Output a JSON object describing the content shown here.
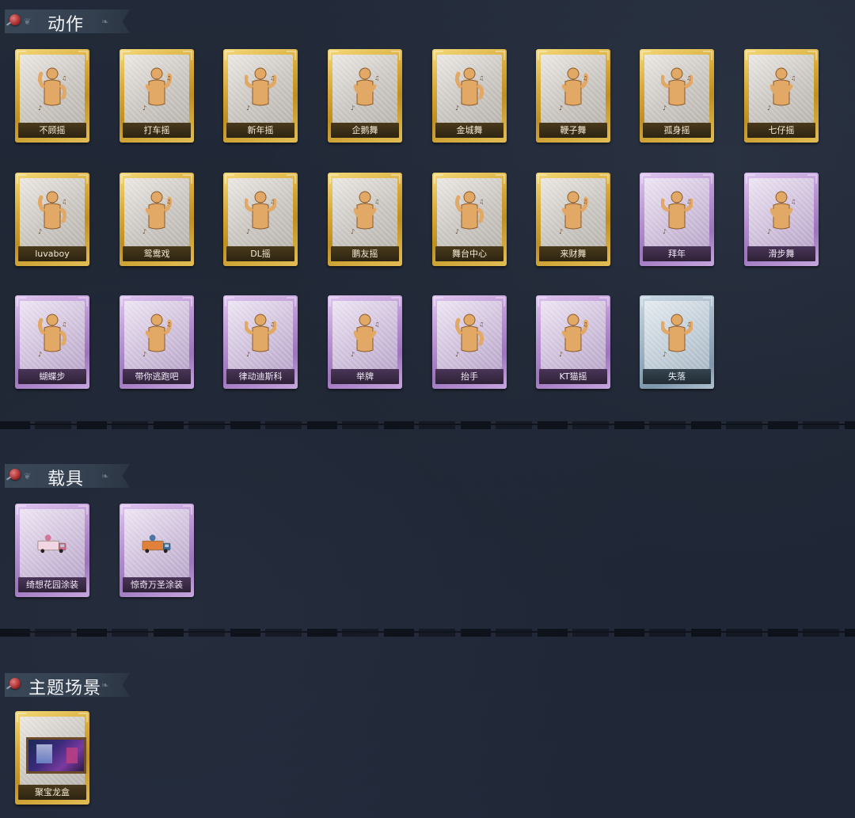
{
  "sections": [
    {
      "title": "动作",
      "items": [
        {
          "label": "不顾摇",
          "rarity": "gold"
        },
        {
          "label": "打车摇",
          "rarity": "gold"
        },
        {
          "label": "新年摇",
          "rarity": "gold"
        },
        {
          "label": "企鹅舞",
          "rarity": "gold"
        },
        {
          "label": "金城舞",
          "rarity": "gold"
        },
        {
          "label": "鞭子舞",
          "rarity": "gold"
        },
        {
          "label": "孤身摇",
          "rarity": "gold"
        },
        {
          "label": "七仔摇",
          "rarity": "gold"
        },
        {
          "label": "luvaboy",
          "rarity": "gold"
        },
        {
          "label": "鸳鸯戏",
          "rarity": "gold"
        },
        {
          "label": "DL摇",
          "rarity": "gold"
        },
        {
          "label": "鹏友摇",
          "rarity": "gold"
        },
        {
          "label": "舞台中心",
          "rarity": "gold"
        },
        {
          "label": "来财舞",
          "rarity": "gold"
        },
        {
          "label": "拜年",
          "rarity": "purple"
        },
        {
          "label": "滑步舞",
          "rarity": "purple"
        },
        {
          "label": "蝴蝶步",
          "rarity": "purple"
        },
        {
          "label": "带你逃跑吧",
          "rarity": "purple"
        },
        {
          "label": "律动迪斯科",
          "rarity": "purple"
        },
        {
          "label": "举牌",
          "rarity": "purple"
        },
        {
          "label": "抬手",
          "rarity": "purple"
        },
        {
          "label": "KT猫摇",
          "rarity": "purple"
        },
        {
          "label": "失落",
          "rarity": "blue"
        }
      ]
    },
    {
      "title": "载具",
      "items": [
        {
          "label": "绮想花园涂装",
          "rarity": "purple"
        },
        {
          "label": "惊奇万圣涂装",
          "rarity": "purple"
        }
      ]
    },
    {
      "title": "主题场景",
      "items": [
        {
          "label": "聚宝龙盒",
          "rarity": "gold"
        }
      ]
    }
  ],
  "icons": {
    "header_pin": "pin-icon",
    "emote": "dancer-silhouette-icon",
    "vehicle": "truck-icon",
    "scene": "stage-scene-icon"
  },
  "colors": {
    "background": "#1f2736",
    "gold": "#d7a937",
    "purple": "#b892d2",
    "blue": "#9fb3c4"
  }
}
